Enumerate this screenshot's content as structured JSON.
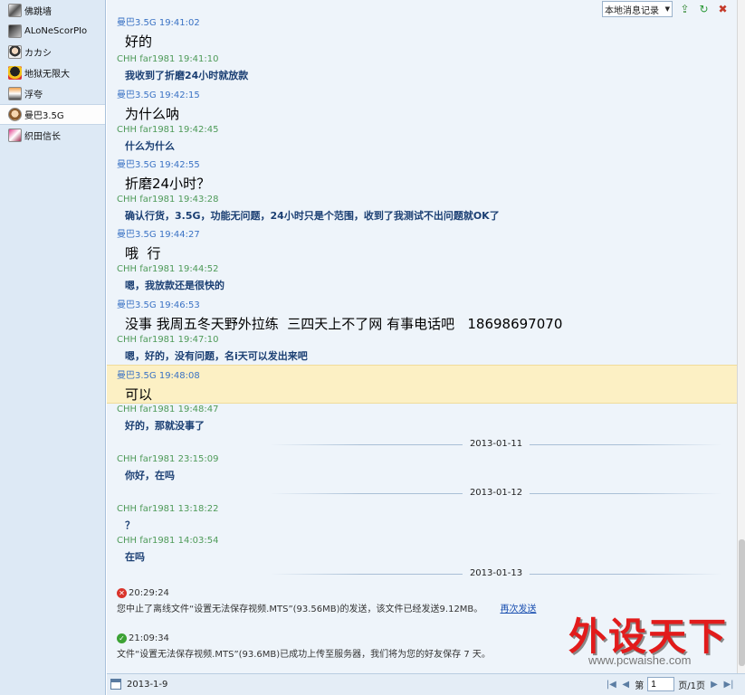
{
  "sidebar": {
    "contacts": [
      {
        "name": "佛跳墙"
      },
      {
        "name": "ALoNeScorPIo"
      },
      {
        "name": "カカシ"
      },
      {
        "name": "地狱无限大"
      },
      {
        "name": "浮夸"
      },
      {
        "name": "曼巴3.5G"
      },
      {
        "name": "织田信长"
      }
    ],
    "selected_index": 5
  },
  "toolbar": {
    "record_select": "本地消息记录",
    "dropdown_arrow": "▼",
    "export_glyph": "⇪",
    "refresh_glyph": "↻",
    "close_glyph": "✖"
  },
  "messages": [
    {
      "sender": "曼巴3.5G 19:41:02",
      "text": "好的"
    },
    {
      "sender": "CHH far1981 19:41:10",
      "text": "我收到了折磨24小时就放款"
    },
    {
      "sender": "曼巴3.5G 19:42:15",
      "text": "为什么呐"
    },
    {
      "sender": "CHH far1981 19:42:45",
      "text": "什么为什么"
    },
    {
      "sender": "曼巴3.5G 19:42:55",
      "text": "折磨24小时？"
    },
    {
      "sender": "CHH far1981 19:43:28",
      "text": "确认行货，3.5G，功能无问题，24小时只是个范围，收到了我测试不出问题就OK了"
    },
    {
      "sender": "曼巴3.5G 19:44:27",
      "text": "哦  行"
    },
    {
      "sender": "CHH far1981 19:44:52",
      "text": "嗯，我放款还是很快的"
    },
    {
      "sender": "曼巴3.5G 19:46:53",
      "text": "没事 我周五冬天野外拉练  三四天上不了网 有事电话吧   18698697070"
    },
    {
      "sender": "CHH far1981 19:47:10",
      "text": "嗯，好的，没有问题，名i天可以发出来吧"
    },
    {
      "sender": "曼巴3.5G 19:48:08",
      "text": "可以"
    },
    {
      "sender": "CHH far1981 19:48:47",
      "text": "好的，那就没事了"
    },
    {
      "sender": "CHH far1981 23:15:09",
      "text": "你好，在吗"
    },
    {
      "sender": "CHH far1981 13:18:22",
      "text": "？"
    },
    {
      "sender": "CHH far1981 14:03:54",
      "text": "在吗"
    }
  ],
  "date_separators": [
    "2013-01-11",
    "2013-01-12",
    "2013-01-13"
  ],
  "system": [
    {
      "time": "20:29:24",
      "status": "error",
      "text": "您中止了离线文件“设置无法保存视频.MTS”(93.56MB)的发送，该文件已经发送9.12MB。",
      "link": "再次发送"
    },
    {
      "time": "21:09:34",
      "status": "ok",
      "text": "文件“设置无法保存视频.MTS”(93.6MB)已成功上传至服务器，我们将为您的好友保存 7 天。"
    }
  ],
  "bottombar": {
    "date": "2013-1-9",
    "first_glyph": "|◀",
    "prev_glyph": "◀",
    "page_prefix": "第",
    "page_value": "1",
    "page_suffix": "页/1页",
    "next_glyph": "▶",
    "last_glyph": "▶|"
  },
  "watermark": {
    "main": "外设天下",
    "sub": "www.pcwaishe.com"
  }
}
